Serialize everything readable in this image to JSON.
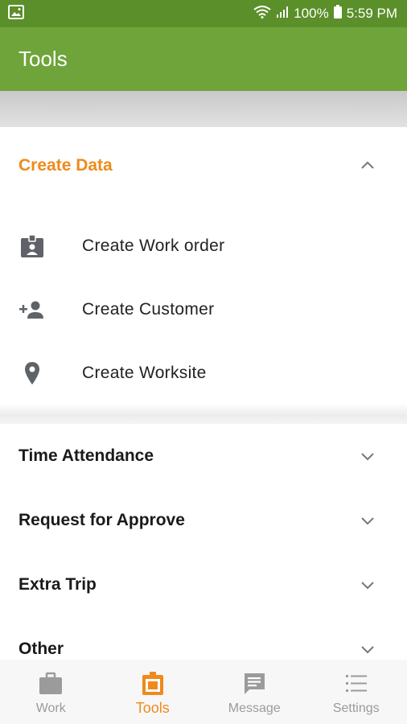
{
  "status": {
    "battery": "100%",
    "time": "5:59 PM"
  },
  "app_bar": {
    "title": "Tools"
  },
  "sections": [
    {
      "title": "Create Data",
      "expanded": true,
      "items": [
        {
          "label": "Create Work order",
          "icon": "badge-icon"
        },
        {
          "label": "Create Customer",
          "icon": "person-add-icon"
        },
        {
          "label": "Create Worksite",
          "icon": "location-pin-icon"
        }
      ]
    },
    {
      "title": "Time Attendance",
      "expanded": false
    },
    {
      "title": "Request for Approve",
      "expanded": false
    },
    {
      "title": "Extra Trip",
      "expanded": false
    },
    {
      "title": "Other",
      "expanded": false
    }
  ],
  "bottom_nav": {
    "items": [
      {
        "label": "Work",
        "icon": "briefcase-icon"
      },
      {
        "label": "Tools",
        "icon": "tools-icon",
        "active": true
      },
      {
        "label": "Message",
        "icon": "message-icon"
      },
      {
        "label": "Settings",
        "icon": "list-settings-icon"
      }
    ]
  },
  "colors": {
    "header": "#6ea43a",
    "status": "#5a8f2a",
    "accent": "#ef8a1c"
  }
}
